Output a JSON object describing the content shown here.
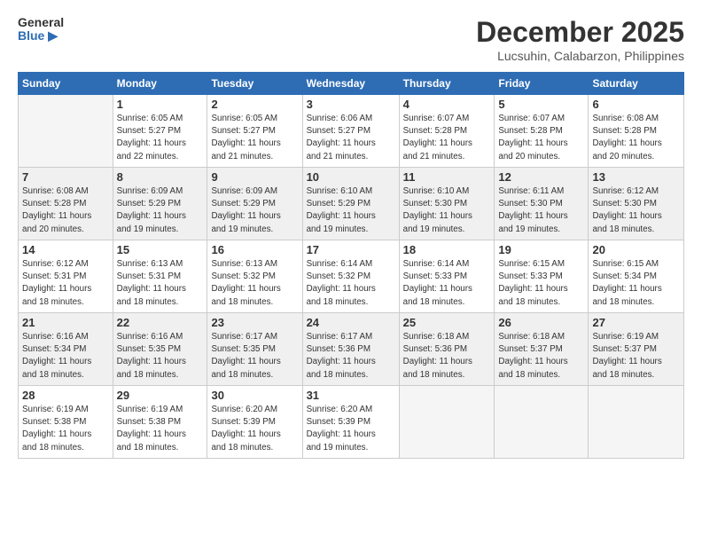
{
  "logo": {
    "general": "General",
    "blue": "Blue"
  },
  "header": {
    "month": "December 2025",
    "location": "Lucsuhin, Calabarzon, Philippines"
  },
  "weekdays": [
    "Sunday",
    "Monday",
    "Tuesday",
    "Wednesday",
    "Thursday",
    "Friday",
    "Saturday"
  ],
  "weeks": [
    [
      {
        "day": "",
        "info": ""
      },
      {
        "day": "1",
        "info": "Sunrise: 6:05 AM\nSunset: 5:27 PM\nDaylight: 11 hours\nand 22 minutes."
      },
      {
        "day": "2",
        "info": "Sunrise: 6:05 AM\nSunset: 5:27 PM\nDaylight: 11 hours\nand 21 minutes."
      },
      {
        "day": "3",
        "info": "Sunrise: 6:06 AM\nSunset: 5:27 PM\nDaylight: 11 hours\nand 21 minutes."
      },
      {
        "day": "4",
        "info": "Sunrise: 6:07 AM\nSunset: 5:28 PM\nDaylight: 11 hours\nand 21 minutes."
      },
      {
        "day": "5",
        "info": "Sunrise: 6:07 AM\nSunset: 5:28 PM\nDaylight: 11 hours\nand 20 minutes."
      },
      {
        "day": "6",
        "info": "Sunrise: 6:08 AM\nSunset: 5:28 PM\nDaylight: 11 hours\nand 20 minutes."
      }
    ],
    [
      {
        "day": "7",
        "info": "Sunrise: 6:08 AM\nSunset: 5:28 PM\nDaylight: 11 hours\nand 20 minutes."
      },
      {
        "day": "8",
        "info": "Sunrise: 6:09 AM\nSunset: 5:29 PM\nDaylight: 11 hours\nand 19 minutes."
      },
      {
        "day": "9",
        "info": "Sunrise: 6:09 AM\nSunset: 5:29 PM\nDaylight: 11 hours\nand 19 minutes."
      },
      {
        "day": "10",
        "info": "Sunrise: 6:10 AM\nSunset: 5:29 PM\nDaylight: 11 hours\nand 19 minutes."
      },
      {
        "day": "11",
        "info": "Sunrise: 6:10 AM\nSunset: 5:30 PM\nDaylight: 11 hours\nand 19 minutes."
      },
      {
        "day": "12",
        "info": "Sunrise: 6:11 AM\nSunset: 5:30 PM\nDaylight: 11 hours\nand 19 minutes."
      },
      {
        "day": "13",
        "info": "Sunrise: 6:12 AM\nSunset: 5:30 PM\nDaylight: 11 hours\nand 18 minutes."
      }
    ],
    [
      {
        "day": "14",
        "info": "Sunrise: 6:12 AM\nSunset: 5:31 PM\nDaylight: 11 hours\nand 18 minutes."
      },
      {
        "day": "15",
        "info": "Sunrise: 6:13 AM\nSunset: 5:31 PM\nDaylight: 11 hours\nand 18 minutes."
      },
      {
        "day": "16",
        "info": "Sunrise: 6:13 AM\nSunset: 5:32 PM\nDaylight: 11 hours\nand 18 minutes."
      },
      {
        "day": "17",
        "info": "Sunrise: 6:14 AM\nSunset: 5:32 PM\nDaylight: 11 hours\nand 18 minutes."
      },
      {
        "day": "18",
        "info": "Sunrise: 6:14 AM\nSunset: 5:33 PM\nDaylight: 11 hours\nand 18 minutes."
      },
      {
        "day": "19",
        "info": "Sunrise: 6:15 AM\nSunset: 5:33 PM\nDaylight: 11 hours\nand 18 minutes."
      },
      {
        "day": "20",
        "info": "Sunrise: 6:15 AM\nSunset: 5:34 PM\nDaylight: 11 hours\nand 18 minutes."
      }
    ],
    [
      {
        "day": "21",
        "info": "Sunrise: 6:16 AM\nSunset: 5:34 PM\nDaylight: 11 hours\nand 18 minutes."
      },
      {
        "day": "22",
        "info": "Sunrise: 6:16 AM\nSunset: 5:35 PM\nDaylight: 11 hours\nand 18 minutes."
      },
      {
        "day": "23",
        "info": "Sunrise: 6:17 AM\nSunset: 5:35 PM\nDaylight: 11 hours\nand 18 minutes."
      },
      {
        "day": "24",
        "info": "Sunrise: 6:17 AM\nSunset: 5:36 PM\nDaylight: 11 hours\nand 18 minutes."
      },
      {
        "day": "25",
        "info": "Sunrise: 6:18 AM\nSunset: 5:36 PM\nDaylight: 11 hours\nand 18 minutes."
      },
      {
        "day": "26",
        "info": "Sunrise: 6:18 AM\nSunset: 5:37 PM\nDaylight: 11 hours\nand 18 minutes."
      },
      {
        "day": "27",
        "info": "Sunrise: 6:19 AM\nSunset: 5:37 PM\nDaylight: 11 hours\nand 18 minutes."
      }
    ],
    [
      {
        "day": "28",
        "info": "Sunrise: 6:19 AM\nSunset: 5:38 PM\nDaylight: 11 hours\nand 18 minutes."
      },
      {
        "day": "29",
        "info": "Sunrise: 6:19 AM\nSunset: 5:38 PM\nDaylight: 11 hours\nand 18 minutes."
      },
      {
        "day": "30",
        "info": "Sunrise: 6:20 AM\nSunset: 5:39 PM\nDaylight: 11 hours\nand 18 minutes."
      },
      {
        "day": "31",
        "info": "Sunrise: 6:20 AM\nSunset: 5:39 PM\nDaylight: 11 hours\nand 19 minutes."
      },
      {
        "day": "",
        "info": ""
      },
      {
        "day": "",
        "info": ""
      },
      {
        "day": "",
        "info": ""
      }
    ]
  ]
}
